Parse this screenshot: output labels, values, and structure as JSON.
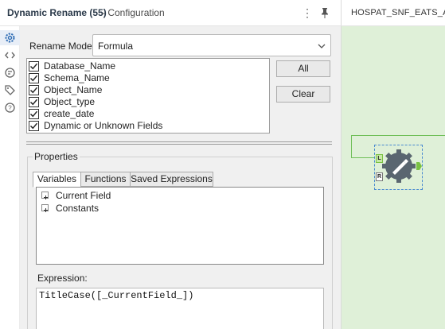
{
  "header": {
    "title": "Dynamic Rename (55)",
    "subtitle": "- Configuration",
    "more_glyph": "⋮",
    "pin_icon": "pin-icon"
  },
  "rail": {
    "items": [
      {
        "icon": "gear-icon",
        "selected": true
      },
      {
        "icon": "code-icon",
        "selected": false
      },
      {
        "icon": "annotation-icon",
        "selected": false
      },
      {
        "icon": "tag-icon",
        "selected": false
      },
      {
        "icon": "help-icon",
        "selected": false
      }
    ]
  },
  "config": {
    "rename_mode_label": "Rename Mode:",
    "rename_mode_value": "Formula",
    "fields": [
      {
        "label": "Database_Name",
        "checked": true
      },
      {
        "label": "Schema_Name",
        "checked": true
      },
      {
        "label": "Object_Name",
        "checked": true
      },
      {
        "label": "Object_type",
        "checked": true
      },
      {
        "label": "create_date",
        "checked": true
      },
      {
        "label": "Dynamic or Unknown Fields",
        "checked": true
      }
    ],
    "all_button": "All",
    "clear_button": "Clear"
  },
  "properties": {
    "group_label": "Properties",
    "tabs": [
      {
        "label": "Variables",
        "active": true
      },
      {
        "label": "Functions",
        "active": false
      },
      {
        "label": "Saved Expressions",
        "active": false
      }
    ],
    "tree": [
      {
        "label": "Current Field"
      },
      {
        "label": "Constants"
      }
    ],
    "expression_label": "Expression:",
    "expression_value": "TitleCase([_CurrentField_])"
  },
  "canvas": {
    "tab_title": "HOSPAT_SNF_EATS_AH_",
    "background": "#dff0d8",
    "connector_color": "#6fbf58",
    "tool_color": "#5a6670",
    "input_anchors": [
      "L",
      "R"
    ]
  }
}
